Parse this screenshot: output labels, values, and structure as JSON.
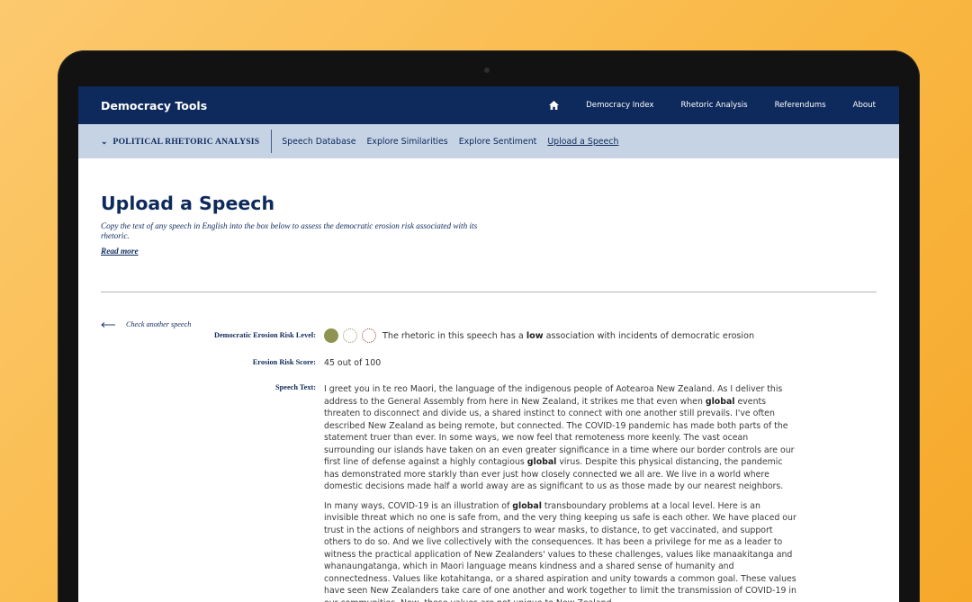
{
  "nav": {
    "brand": "Democracy Tools",
    "links": [
      "Democracy Index",
      "Rhetoric Analysis",
      "Referendums",
      "About"
    ]
  },
  "subnav": {
    "section_title": "POLITICAL RHETORIC ANALYSIS",
    "links": [
      "Speech Database",
      "Explore Similarities",
      "Explore Sentiment",
      "Upload a Speech"
    ],
    "active": "Upload a Speech"
  },
  "page": {
    "title": "Upload a Speech",
    "intro": "Copy the text of any speech in English into the box below to assess the democratic erosion risk associated with its rhetoric.",
    "read_more": "Read more",
    "back_link": "Check another speech"
  },
  "result": {
    "risk_label": "Democratic Erosion Risk Level:",
    "risk_level_filled": 1,
    "risk_level_total": 3,
    "risk_text_before": "The rhetoric in this speech has a ",
    "risk_text_bold": "low",
    "risk_text_after": " association with incidents of democratic erosion",
    "score_label": "Erosion Risk Score:",
    "score_value": "45 out of 100",
    "speech_label": "Speech Text:"
  },
  "speech": {
    "p1": [
      "I greet you in te reo Maori, the language of the indigenous people of Aotearoa New Zealand. As I deliver this address to the General Assembly from here in New Zealand, it strikes me that even when ",
      "global",
      " events threaten to disconnect and divide us, a shared instinct to connect with one another still prevails. I've often described New Zealand as being remote, but connected. The COVID-19 pandemic has made both parts of the statement truer than ever. In some ways, we now feel that remoteness more keenly. The vast ocean surrounding our islands have taken on an even greater significance in a time where our border controls are our first line of defense against a highly contagious ",
      "global",
      " virus. Despite this physical distancing, the pandemic has demonstrated more starkly than ever just how closely connected we all are. We live in a world where domestic decisions made half a world away are as significant to us as those made by our nearest neighbors."
    ],
    "p2": [
      "In many ways, COVID-19 is an illustration of ",
      "global",
      " transboundary problems at a local level. Here is an invisible threat which no one is safe from, and the very thing keeping us safe is each other. We have placed our trust in the actions of neighbors and strangers to wear masks, to distance, to get vaccinated, and support others to do so. And we live collectively with the consequences. It has been a privilege for me as a leader to witness the practical application of New Zealanders' values to these challenges, values like manaakitanga and whanaungatanga, which in Maori language means kindness and a shared sense of humanity and connectedness. Values like kotahitanga, or a shared aspiration and unity towards a common goal. These values have seen New Zealanders take care of one another and work together to limit the transmission of COVID-19 in our communities. Now, these values are not unique to New Zealand."
    ]
  }
}
